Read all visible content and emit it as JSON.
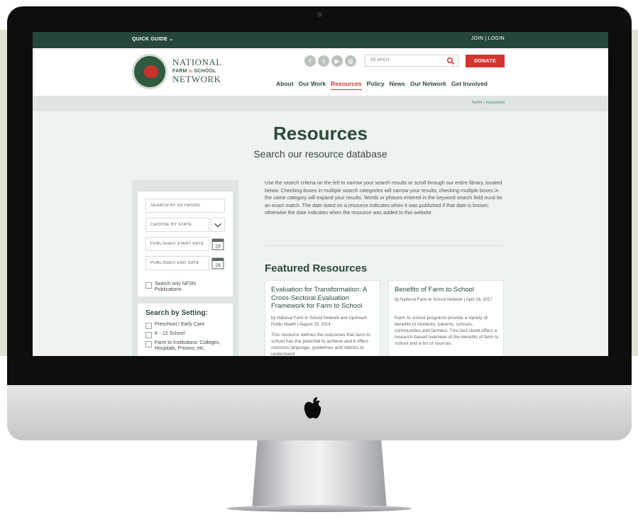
{
  "topbar": {
    "quick_guide": "QUICK GUIDE ⌄",
    "join": "JOIN",
    "sep": "|",
    "login": "LOGIN"
  },
  "logo": {
    "line1": "NATIONAL",
    "line2_a": "FARM",
    "line2_to": "to",
    "line2_b": "SCHOOL",
    "line3": "NETWORK"
  },
  "social": {
    "facebook": "f",
    "twitter": "t",
    "youtube": "▶",
    "instagram": "◎"
  },
  "search": {
    "placeholder": "SEARCH"
  },
  "donate_label": "DONATE",
  "nav": [
    "About",
    "Our Work",
    "Resources",
    "Policy",
    "News",
    "Our Network",
    "Get Involved"
  ],
  "breadcrumb": {
    "home": "home",
    "sep": "|",
    "current": "resources"
  },
  "page": {
    "title": "Resources",
    "subtitle": "Search our resource database"
  },
  "filters": {
    "keyword": "SEARCH BY KEYWORD",
    "state": "CHOOSE BY STATE",
    "start_date": "PUBLISHED START DATE",
    "end_date": "PUBLISHED END DATE",
    "calendar_day": "28",
    "nfsn_only": "Search only NFSN Publications"
  },
  "setting": {
    "title": "Search by Setting:",
    "items": [
      "Preschool / Early Care",
      "K - 12 School",
      "Farm to Institutions: Colleges, Hospitals, Prisons, etc."
    ]
  },
  "intro": "Use the search criteria on the left to narrow your search results or scroll through our entire library, located below. Checking boxes in multiple search categories will narrow your results; checking multiple boxes in the same category will expand your results. Words or phases entered in the keyword search field must be an exact match. The date listed on a resource indicates when it was published if that date is known; otherwise the date indicates when the resource was added to this website.",
  "featured": {
    "title": "Featured Resources",
    "cards": [
      {
        "title": "Evaluation for Transformation: A Cross-Sectoral Evaluation Framework for Farm to School",
        "meta": "by National Farm to School Network and Upstream Public Health | August 25, 2014",
        "body": "This resource defines the outcomes that farm to school has the potential to achieve and it offers common language, guidelines and metrics to understand"
      },
      {
        "title": "Benefits of Farm to School",
        "meta": "by National Farm to School Network | April 26, 2017",
        "body": "Farm to school programs provide a variety of benefits to students, parents, schools, communities and farmers. This fact sheet offers a research-based overview of the benefits of farm to school and a list of sources."
      }
    ]
  },
  "colors": {
    "brand_green": "#24473a",
    "accent_red": "#d7322f",
    "link_green": "#3a8a67"
  }
}
